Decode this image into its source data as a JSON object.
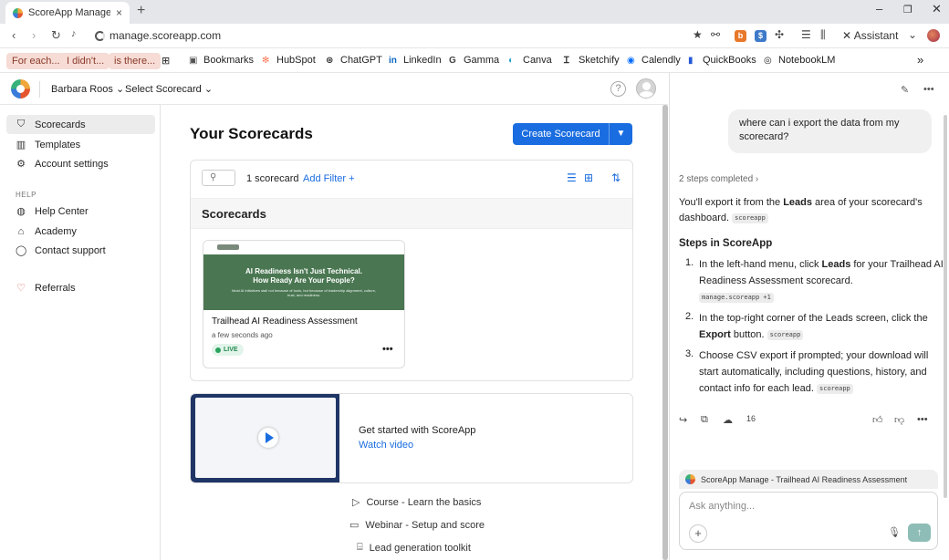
{
  "browser": {
    "tab_title": "ScoreApp Manage - Trail",
    "url": "manage.scoreapp.com",
    "assistant_label": "Assistant",
    "new_tab": "+",
    "minimize": "–",
    "maximize": "❐",
    "close": "✕"
  },
  "bookmarks": {
    "chips": [
      "For each...",
      "I didn't...",
      "is there..."
    ],
    "items": [
      {
        "label": "Bookmarks",
        "icon": "bookmark-icon",
        "color": "#555555"
      },
      {
        "label": "HubSpot",
        "icon": "hubspot-icon",
        "color": "#ff7a59"
      },
      {
        "label": "ChatGPT",
        "icon": "chatgpt-icon",
        "color": "#333333"
      },
      {
        "label": "LinkedIn",
        "icon": "linkedin-icon",
        "color": "#0a66c2"
      },
      {
        "label": "Gamma",
        "icon": "gamma-icon",
        "color": "#444444"
      },
      {
        "label": "Canva",
        "icon": "canva-icon",
        "color": "#1fa3c9"
      },
      {
        "label": "Sketchify",
        "icon": "sketchify-icon",
        "color": "#333333"
      },
      {
        "label": "Calendly",
        "icon": "calendly-icon",
        "color": "#006bff"
      },
      {
        "label": "QuickBooks",
        "icon": "quickbooks-icon",
        "color": "#2559d6"
      },
      {
        "label": "NotebookLM",
        "icon": "notebooklm-icon",
        "color": "#222222"
      }
    ],
    "overflow": "»"
  },
  "header": {
    "user_menu": "Barbara Roos",
    "scorecard_menu": "Select Scorecard",
    "help": "?"
  },
  "sidebar": {
    "items": [
      {
        "label": "Scorecards",
        "icon": "filter-icon",
        "glyph": "⛉",
        "active": true
      },
      {
        "label": "Templates",
        "icon": "book-icon",
        "glyph": "▥",
        "active": false
      },
      {
        "label": "Account settings",
        "icon": "gear-icon",
        "glyph": "⚙",
        "active": false
      }
    ],
    "help_heading": "HELP",
    "help_items": [
      {
        "label": "Help Center",
        "icon": "globe-icon",
        "glyph": "◍"
      },
      {
        "label": "Academy",
        "icon": "graduation-cap-icon",
        "glyph": "🎓"
      },
      {
        "label": "Contact support",
        "icon": "chat-bubble-icon",
        "glyph": "◯"
      }
    ],
    "referrals": {
      "label": "Referrals",
      "icon": "heart-icon",
      "glyph": "♡"
    }
  },
  "main": {
    "title": "Your Scorecards",
    "create_button": "Create Scorecard",
    "search_icon": "⚲",
    "count": "1 scorecard",
    "add_filter": "Add Filter",
    "section_title": "Scorecards",
    "scorecard": {
      "thumbnail_heading": "AI Readiness Isn't Just Technical. How Ready Are Your People?",
      "thumbnail_sub": "Most AI initiatives stall not because of tools, but because of leadership alignment, culture, trust, and readiness.",
      "name": "Trailhead AI Readiness Assessment",
      "updated": "a few seconds ago",
      "status": "LIVE",
      "status_color": "#2aa35e"
    },
    "video": {
      "heading": "Get started with ScoreApp",
      "link": "Watch video"
    },
    "resources": [
      {
        "label": "Course - Learn the basics",
        "icon": "play-outline-icon",
        "glyph": "▷"
      },
      {
        "label": "Webinar - Setup and score",
        "icon": "video-camera-icon",
        "glyph": "▭"
      },
      {
        "label": "Lead generation toolkit",
        "icon": "toolbox-icon",
        "glyph": "⌸"
      }
    ]
  },
  "assistant": {
    "user_message": "where can i export the data from my scorecard?",
    "steps_completed": "2 steps completed ›",
    "intro_1": "You'll export it from the ",
    "intro_bold": "Leads",
    "intro_2": " area of your scorecard's dashboard.",
    "intro_tag": "scoreapp",
    "steps_heading": "Steps in ScoreApp",
    "steps": [
      {
        "num": "1.",
        "pre": "In the left-hand menu, click ",
        "bold": "Leads",
        "post": " for your Trailhead AI Readiness Assessment scorecard.",
        "tag": "manage.scoreapp +1"
      },
      {
        "num": "2.",
        "pre": "In the top-right corner of the Leads screen, click the ",
        "bold": "Export",
        "post": " button.",
        "tag": "scoreapp"
      },
      {
        "num": "3.",
        "pre": "Choose CSV export if prompted; your download will start automatically, including questions, history, and contact info for each lead.",
        "bold": "",
        "post": "",
        "tag": "scoreapp"
      }
    ],
    "sources_count": "16",
    "context_label": "ScoreApp Manage - Trailhead AI Readiness Assessment",
    "input_placeholder": "Ask anything..."
  }
}
